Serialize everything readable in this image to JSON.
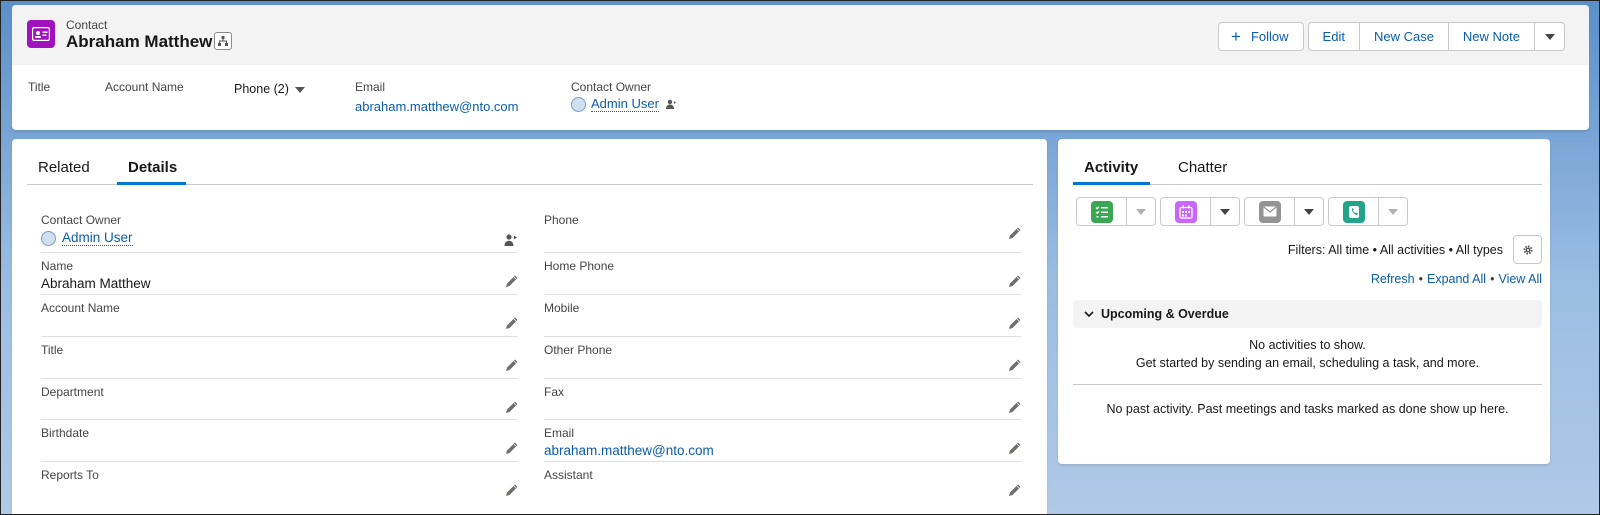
{
  "record": {
    "object_type": "Contact",
    "name": "Abraham Matthew",
    "icon": "contact-card-icon",
    "accent_color": "#a012bd"
  },
  "actions": {
    "follow": "Follow",
    "edit": "Edit",
    "new_case": "New Case",
    "new_note": "New Note"
  },
  "highlights": {
    "title_label": "Title",
    "account_name_label": "Account Name",
    "phone_label": "Phone (2)",
    "email_label": "Email",
    "email_value": "abraham.matthew@nto.com",
    "owner_label": "Contact Owner",
    "owner_value": "Admin User"
  },
  "detail_tabs": {
    "related": "Related",
    "details": "Details"
  },
  "details": {
    "contact_owner_label": "Contact Owner",
    "contact_owner_value": "Admin User",
    "phone_label": "Phone",
    "name_label": "Name",
    "name_value": "Abraham Matthew",
    "home_phone_label": "Home Phone",
    "account_name_label": "Account Name",
    "mobile_label": "Mobile",
    "title_label": "Title",
    "other_phone_label": "Other Phone",
    "department_label": "Department",
    "fax_label": "Fax",
    "birthdate_label": "Birthdate",
    "email_label": "Email",
    "email_value": "abraham.matthew@nto.com",
    "reports_to_label": "Reports To",
    "assistant_label": "Assistant"
  },
  "activity": {
    "tab_activity": "Activity",
    "tab_chatter": "Chatter",
    "filters": "Filters: All time • All activities • All types",
    "refresh": "Refresh",
    "expand_all": "Expand All",
    "view_all": "View All",
    "upcoming_title": "Upcoming & Overdue",
    "no_activities": "No activities to show.",
    "get_started": "Get started by sending an email, scheduling a task, and more.",
    "no_past": "No past activity. Past meetings and tasks marked as done show up here.",
    "colors": {
      "task": "#3ba755",
      "event": "#cb65ff",
      "email": "#939393",
      "call": "#22a48a"
    }
  }
}
